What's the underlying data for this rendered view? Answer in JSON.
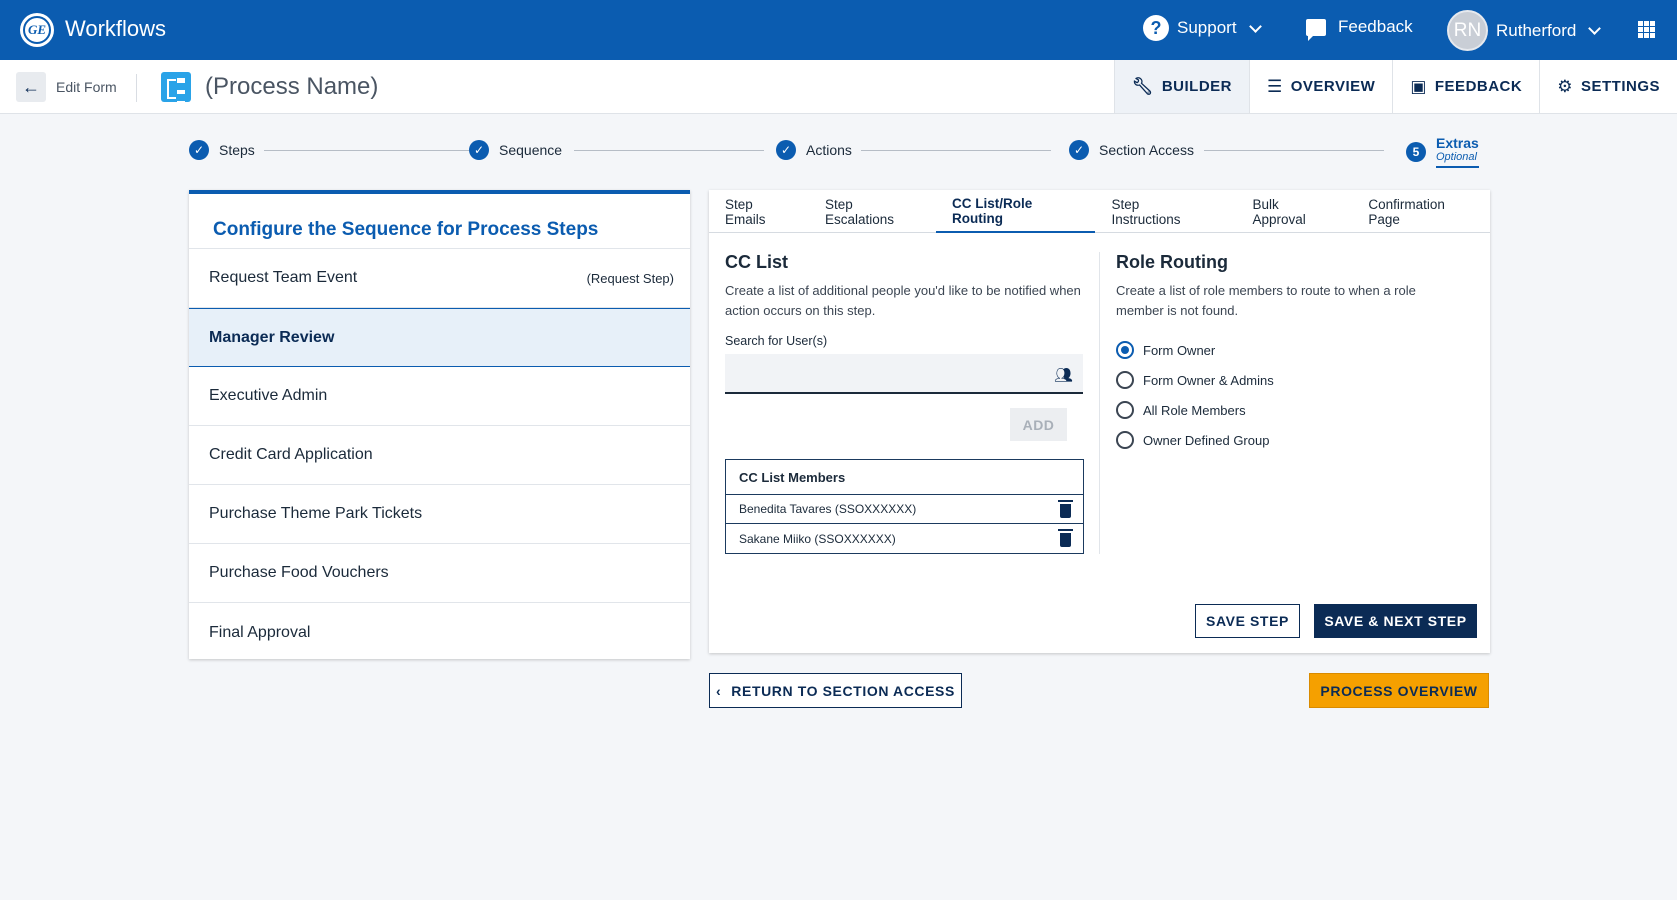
{
  "app": {
    "title": "Workflows",
    "logo_text": "GE"
  },
  "topbar": {
    "support_label": "Support",
    "feedback_label": "Feedback",
    "user_initials": "RN",
    "user_name": "Rutherford"
  },
  "subbar": {
    "back_label": "Edit Form",
    "process_name": "(Process Name)",
    "tabs": [
      {
        "label": "BUILDER",
        "icon": "wrench-icon",
        "active": true
      },
      {
        "label": "OVERVIEW",
        "icon": "list-icon"
      },
      {
        "label": "FEEDBACK",
        "icon": "feedback-icon"
      },
      {
        "label": "SETTINGS",
        "icon": "gear-icon"
      }
    ]
  },
  "stepper": {
    "steps": [
      "Steps",
      "Sequence",
      "Actions",
      "Section Access"
    ],
    "current": {
      "number": "5",
      "label": "Extras",
      "sublabel": "Optional"
    }
  },
  "sequence": {
    "title": "Configure the Sequence for Process Steps",
    "items": [
      {
        "label": "Request Team Event",
        "tag": "(Request Step)"
      },
      {
        "label": "Manager Review",
        "selected": true
      },
      {
        "label": "Executive Admin"
      },
      {
        "label": "Credit Card Application"
      },
      {
        "label": "Purchase Theme Park Tickets"
      },
      {
        "label": "Purchase Food Vouchers"
      },
      {
        "label": "Final Approval"
      }
    ]
  },
  "tabs": [
    "Step Emails",
    "Step Escalations",
    "CC List/Role Routing",
    "Step Instructions",
    "Bulk Approval",
    "Confirmation Page"
  ],
  "active_tab": "CC List/Role Routing",
  "cc_list": {
    "title": "CC List",
    "description": "Create a list of additional people you'd like to be notified when action occurs on this step.",
    "search_label": "Search for User(s)",
    "search_value": "",
    "add_label": "ADD",
    "members_header": "CC List Members",
    "members": [
      "Benedita Tavares (SSOXXXXXX)",
      "Sakane Miiko (SSOXXXXXX)"
    ]
  },
  "role_routing": {
    "title": "Role Routing",
    "description": "Create a list of role members to route to when a role member is not found.",
    "options": [
      "Form Owner",
      "Form Owner & Admins",
      "All Role Members",
      "Owner Defined Group"
    ],
    "selected": "Form Owner"
  },
  "actions": {
    "save_step": "SAVE STEP",
    "save_next_step": "SAVE & NEXT STEP",
    "return_label": "RETURN TO SECTION ACCESS",
    "process_overview": "PROCESS OVERVIEW"
  },
  "colors": {
    "primary": "#0b5cb0",
    "dark": "#0b2b55",
    "accent": "#f5a000"
  }
}
